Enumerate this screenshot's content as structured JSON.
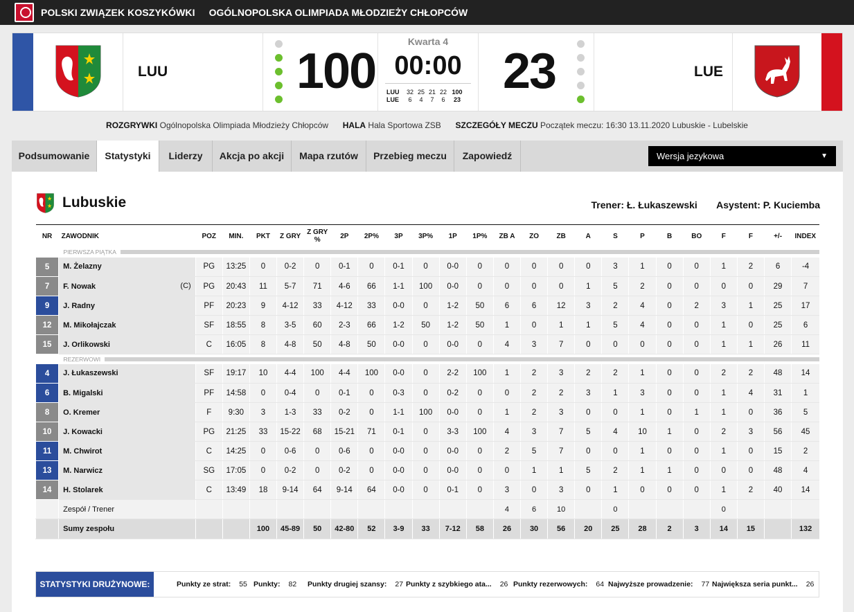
{
  "topbar": {
    "org": "POLSKI ZWIĄZEK KOSZYKÓWKI",
    "competition": "OGÓLNOPOLSKA OLIMPIADA MŁODZIEŻY CHŁOPCÓW"
  },
  "colors": {
    "home_stripe": "#2f55a6",
    "away_stripe": "#d4121e",
    "accent_blue": "#2b4d9c",
    "dot_green": "#6cbf2e"
  },
  "scoreboard": {
    "home_code": "LUU",
    "away_code": "LUE",
    "home_score": "100",
    "away_score": "23",
    "quarter": "Kwarta 4",
    "clock": "00:00",
    "home_timeouts_used": [
      false,
      true,
      true,
      true,
      true
    ],
    "away_timeouts_used": [
      false,
      false,
      false,
      false,
      true
    ],
    "quarters": [
      {
        "team": "LUU",
        "q": [
          "32",
          "25",
          "21",
          "22"
        ],
        "total": "100"
      },
      {
        "team": "LUE",
        "q": [
          "6",
          "4",
          "7",
          "6"
        ],
        "total": "23"
      }
    ]
  },
  "match_info": {
    "competition_label": "ROZGRYWKI",
    "competition_value": "Ogólnopolska Olimpiada Młodzieży Chłopców",
    "hall_label": "HALA",
    "hall_value": "Hala Sportowa ZSB",
    "details_label": "SZCZEGÓŁY MECZU",
    "details_value": "Początek meczu: 16:30 13.11.2020 Lubuskie - Lubelskie"
  },
  "tabs": [
    "Podsumowanie",
    "Statystyki",
    "Liderzy",
    "Akcja po akcji",
    "Mapa rzutów",
    "Przebieg meczu",
    "Zapowiedź"
  ],
  "active_tab": "Statystyki",
  "language_select": {
    "value": "Wersja jezykowa"
  },
  "team": {
    "name": "Lubuskie",
    "coach_label": "Trener:",
    "coach": "Ł. Łukaszewski",
    "assistant_label": "Asystent:",
    "assistant": "P. Kuciemba"
  },
  "table": {
    "headers": [
      "NR",
      "ZAWODNIK",
      "POZ",
      "MIN.",
      "PKT",
      "Z GRY",
      "Z GRY %",
      "2P",
      "2P%",
      "3P",
      "3P%",
      "1P",
      "1P%",
      "ZB A",
      "ZO",
      "ZB",
      "A",
      "S",
      "P",
      "B",
      "BO",
      "F",
      "F",
      "+/-",
      "INDEX"
    ],
    "starters_label": "PIERWSZA PIĄTKA",
    "bench_label": "REZERWOWI",
    "starters": [
      {
        "nr": "5",
        "blue": false,
        "name": "M. Żelazny",
        "cap": "",
        "stats": [
          "PG",
          "13:25",
          "0",
          "0-2",
          "0",
          "0-1",
          "0",
          "0-1",
          "0",
          "0-0",
          "0",
          "0",
          "0",
          "0",
          "0",
          "3",
          "1",
          "0",
          "0",
          "1",
          "2",
          "6",
          "-4"
        ]
      },
      {
        "nr": "7",
        "blue": false,
        "name": "F. Nowak",
        "cap": "(C)",
        "stats": [
          "PG",
          "20:43",
          "11",
          "5-7",
          "71",
          "4-6",
          "66",
          "1-1",
          "100",
          "0-0",
          "0",
          "0",
          "0",
          "0",
          "1",
          "5",
          "2",
          "0",
          "0",
          "0",
          "0",
          "29",
          "7"
        ]
      },
      {
        "nr": "9",
        "blue": true,
        "name": "J. Radny",
        "cap": "",
        "stats": [
          "PF",
          "20:23",
          "9",
          "4-12",
          "33",
          "4-12",
          "33",
          "0-0",
          "0",
          "1-2",
          "50",
          "6",
          "6",
          "12",
          "3",
          "2",
          "4",
          "0",
          "2",
          "3",
          "1",
          "25",
          "17"
        ]
      },
      {
        "nr": "12",
        "blue": false,
        "name": "M. Mikołajczak",
        "cap": "",
        "stats": [
          "SF",
          "18:55",
          "8",
          "3-5",
          "60",
          "2-3",
          "66",
          "1-2",
          "50",
          "1-2",
          "50",
          "1",
          "0",
          "1",
          "1",
          "5",
          "4",
          "0",
          "0",
          "1",
          "0",
          "25",
          "6"
        ]
      },
      {
        "nr": "15",
        "blue": false,
        "name": "J. Orlikowski",
        "cap": "",
        "stats": [
          "C",
          "16:05",
          "8",
          "4-8",
          "50",
          "4-8",
          "50",
          "0-0",
          "0",
          "0-0",
          "0",
          "4",
          "3",
          "7",
          "0",
          "0",
          "0",
          "0",
          "0",
          "1",
          "1",
          "26",
          "11"
        ]
      }
    ],
    "bench": [
      {
        "nr": "4",
        "blue": true,
        "name": "J. Łukaszewski",
        "cap": "",
        "stats": [
          "SF",
          "19:17",
          "10",
          "4-4",
          "100",
          "4-4",
          "100",
          "0-0",
          "0",
          "2-2",
          "100",
          "1",
          "2",
          "3",
          "2",
          "2",
          "1",
          "0",
          "0",
          "2",
          "2",
          "48",
          "14"
        ]
      },
      {
        "nr": "6",
        "blue": true,
        "name": "B. Migalski",
        "cap": "",
        "stats": [
          "PF",
          "14:58",
          "0",
          "0-4",
          "0",
          "0-1",
          "0",
          "0-3",
          "0",
          "0-2",
          "0",
          "0",
          "2",
          "2",
          "3",
          "1",
          "3",
          "0",
          "0",
          "1",
          "4",
          "31",
          "1"
        ]
      },
      {
        "nr": "8",
        "blue": false,
        "name": "O. Kremer",
        "cap": "",
        "stats": [
          "F",
          "9:30",
          "3",
          "1-3",
          "33",
          "0-2",
          "0",
          "1-1",
          "100",
          "0-0",
          "0",
          "1",
          "2",
          "3",
          "0",
          "0",
          "1",
          "0",
          "1",
          "1",
          "0",
          "36",
          "5"
        ]
      },
      {
        "nr": "10",
        "blue": false,
        "name": "J. Kowacki",
        "cap": "",
        "stats": [
          "PG",
          "21:25",
          "33",
          "15-22",
          "68",
          "15-21",
          "71",
          "0-1",
          "0",
          "3-3",
          "100",
          "4",
          "3",
          "7",
          "5",
          "4",
          "10",
          "1",
          "0",
          "2",
          "3",
          "56",
          "45"
        ]
      },
      {
        "nr": "11",
        "blue": true,
        "name": "M. Chwirot",
        "cap": "",
        "stats": [
          "C",
          "14:25",
          "0",
          "0-6",
          "0",
          "0-6",
          "0",
          "0-0",
          "0",
          "0-0",
          "0",
          "2",
          "5",
          "7",
          "0",
          "0",
          "1",
          "0",
          "0",
          "1",
          "0",
          "15",
          "2"
        ]
      },
      {
        "nr": "13",
        "blue": true,
        "name": "M. Narwicz",
        "cap": "",
        "stats": [
          "SG",
          "17:05",
          "0",
          "0-2",
          "0",
          "0-2",
          "0",
          "0-0",
          "0",
          "0-0",
          "0",
          "0",
          "1",
          "1",
          "5",
          "2",
          "1",
          "1",
          "0",
          "0",
          "0",
          "48",
          "4"
        ]
      },
      {
        "nr": "14",
        "blue": false,
        "name": "H. Stolarek",
        "cap": "",
        "stats": [
          "C",
          "13:49",
          "18",
          "9-14",
          "64",
          "9-14",
          "64",
          "0-0",
          "0",
          "0-1",
          "0",
          "3",
          "0",
          "3",
          "0",
          "1",
          "0",
          "0",
          "0",
          "1",
          "2",
          "40",
          "14"
        ]
      }
    ],
    "team_row": {
      "name": "Zespół / Trener",
      "stats": [
        "",
        "",
        "",
        "",
        "",
        "",
        "",
        "",
        "",
        "",
        "",
        "4",
        "6",
        "10",
        "",
        "0",
        "",
        "",
        "",
        "0",
        "",
        "",
        ""
      ]
    },
    "sum_row": {
      "name": "Sumy zespołu",
      "stats": [
        "",
        "",
        "100",
        "45-89",
        "50",
        "42-80",
        "52",
        "3-9",
        "33",
        "7-12",
        "58",
        "26",
        "30",
        "56",
        "20",
        "25",
        "28",
        "2",
        "3",
        "14",
        "15",
        "",
        "132"
      ]
    }
  },
  "team_stats": {
    "label": "STATYSTYKI DRUŻYNOWE:",
    "items": [
      {
        "label": "Punkty ze strat:",
        "value": "55"
      },
      {
        "label": "Punkty:",
        "value": "82"
      },
      {
        "label": "Punkty drugiej szansy:",
        "value": "27"
      },
      {
        "label": "Punkty z szybkiego ata...",
        "value": "26"
      },
      {
        "label": "Punkty rezerwowych:",
        "value": "64"
      },
      {
        "label": "Najwyższe prowadzenie:",
        "value": "77"
      },
      {
        "label": "Największa seria punkt...",
        "value": "26"
      }
    ]
  }
}
